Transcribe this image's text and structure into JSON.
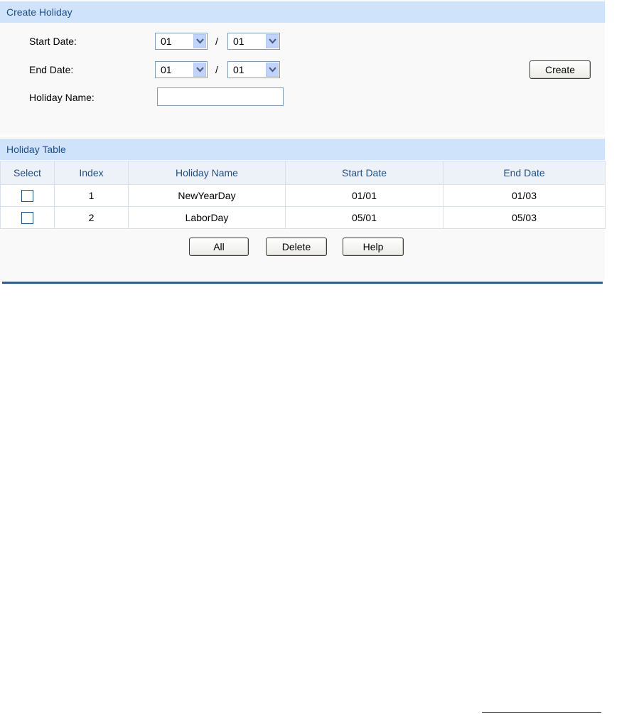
{
  "create_holiday": {
    "header": "Create Holiday",
    "start_date_label": "Start Date:",
    "end_date_label": "End Date:",
    "holiday_name_label": "Holiday Name:",
    "start_month": "01",
    "start_day": "01",
    "end_month": "01",
    "end_day": "01",
    "separator": "/",
    "holiday_name_value": "",
    "create_button": "Create"
  },
  "holiday_table": {
    "header": "Holiday Table",
    "columns": [
      "Select",
      "Index",
      "Holiday Name",
      "Start Date",
      "End Date"
    ],
    "rows": [
      {
        "index": "1",
        "name": "NewYearDay",
        "start": "01/01",
        "end": "01/03",
        "selected": false
      },
      {
        "index": "2",
        "name": "LaborDay",
        "start": "05/01",
        "end": "05/03",
        "selected": false
      }
    ],
    "buttons": {
      "all": "All",
      "delete": "Delete",
      "help": "Help"
    }
  },
  "colors": {
    "header_bg": "#cfe3fb",
    "header_text": "#1f4f8f",
    "rule": "#2f5d8c"
  }
}
